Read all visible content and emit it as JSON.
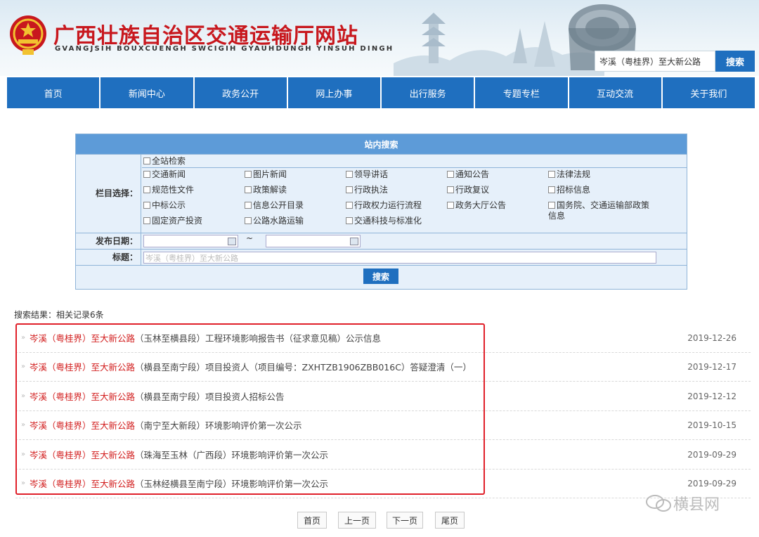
{
  "header": {
    "title": "广西壮族自治区交通运输厅网站",
    "subtitle": "GVANGJSIH BOUXCUENGH SWCIGIH GYAUHDUNGH YINSUH DINGH",
    "search_value": "岑溪（粤桂界）至大新公路",
    "search_button": "搜索"
  },
  "nav": {
    "items": [
      "首页",
      "新闻中心",
      "政务公开",
      "网上办事",
      "出行服务",
      "专题专栏",
      "互动交流",
      "关于我们"
    ]
  },
  "search_panel": {
    "title": "站内搜索",
    "column_label": "栏目选择：",
    "all_site": "全站检索",
    "categories": [
      [
        "交通新闻",
        "图片新闻",
        "领导讲话",
        "通知公告",
        "法律法规"
      ],
      [
        "规范性文件",
        "政策解读",
        "行政执法",
        "行政复议",
        "招标信息"
      ],
      [
        "中标公示",
        "信息公开目录",
        "行政权力运行流程",
        "政务大厅公告",
        "国务院、交通运输部政策信息"
      ],
      [
        "固定资产投资",
        "公路水路运输",
        "交通科技与标准化"
      ]
    ],
    "date_label": "发布日期：",
    "date_sep": "~",
    "title_label": "标题：",
    "title_value": "岑溪（粤桂界）至大新公路",
    "search_button": "搜索"
  },
  "results": {
    "summary": "搜索结果：相关记录6条",
    "items": [
      {
        "highlight": "岑溪（粤桂界）至大新公路",
        "rest": "（玉林至横县段）工程环境影响报告书（征求意见稿）公示信息",
        "date": "2019-12-26"
      },
      {
        "highlight": "岑溪（粤桂界）至大新公路",
        "rest": "（横县至南宁段）项目投资人（项目编号：ZXHTZB1906ZBB016C）答疑澄清（一）",
        "date": "2019-12-17"
      },
      {
        "highlight": "岑溪（粤桂界）至大新公路",
        "rest": "（横县至南宁段）项目投资人招标公告",
        "date": "2019-12-12"
      },
      {
        "highlight": "岑溪（粤桂界）至大新公路",
        "rest": "（南宁至大新段）环境影响评价第一次公示",
        "date": "2019-10-15"
      },
      {
        "highlight": "岑溪（粤桂界）至大新公路",
        "rest": "（珠海至玉林（广西段）环境影响评价第一次公示",
        "date": "2019-09-29"
      },
      {
        "highlight": "岑溪（粤桂界）至大新公路",
        "rest": "（玉林经横县至南宁段）环境影响评价第一次公示",
        "date": "2019-09-29"
      }
    ]
  },
  "pager": {
    "first": "首页",
    "prev": "上一页",
    "next": "下一页",
    "last": "尾页"
  },
  "watermark": "横县网",
  "colors": {
    "brand_blue": "#1f6fbf",
    "title_red": "#c8181e",
    "highlight_red": "#d21e1e"
  }
}
